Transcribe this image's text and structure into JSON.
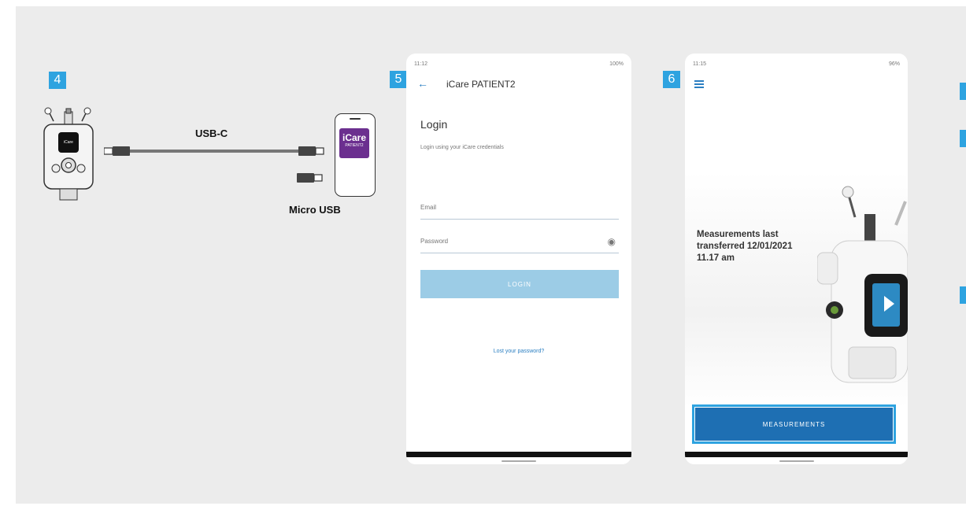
{
  "steps": {
    "s4": "4",
    "s5": "5",
    "s6": "6"
  },
  "connection": {
    "cable_label": "USB-C",
    "alt_connector_label": "Micro USB",
    "app_icon_line1": "iCare",
    "app_icon_line2": "PATIENT2"
  },
  "phone5": {
    "status_time": "11:12",
    "status_right": "100%",
    "app_title": "iCare PATIENT2",
    "login_heading": "Login",
    "login_subtitle": "Login using your iCare credentials",
    "email_placeholder": "Email",
    "password_placeholder": "Password",
    "login_button": "LOGIN",
    "forgot_link": "Lost your password?"
  },
  "phone6": {
    "status_time": "11:15",
    "status_right": "96%",
    "message": "Measurements last transferred 12/01/2021 11.17 am",
    "measurements_button": "MEASUREMENTS"
  },
  "colors": {
    "step_badge": "#2ea3e0",
    "login_button_disabled": "#9ccce6",
    "measurements_button": "#1e6fb3",
    "app_icon": "#6b2f8f"
  },
  "icons": [
    "back-arrow-icon",
    "eye-icon",
    "menu-icon",
    "battery-icon",
    "wifi-icon"
  ]
}
